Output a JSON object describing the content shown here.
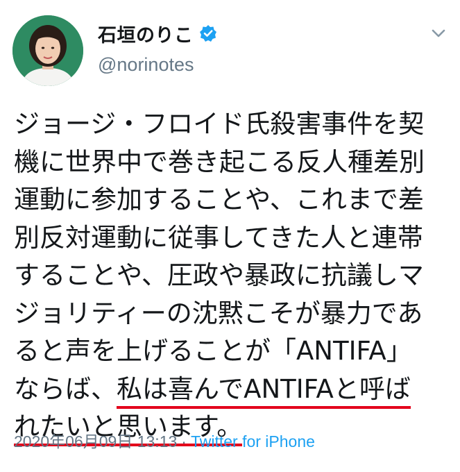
{
  "author": {
    "display_name": "石垣のりこ",
    "handle": "@norinotes",
    "verified": true
  },
  "tweet": {
    "lines": [
      "ジョージ・フロイド氏殺害事件を契",
      "機に世界中で巻き起こる反人種差別",
      "運動に参加することや、これまで差",
      "別反対運動に従事してきた人と連帯",
      "することや、圧政や暴政に抗議しマ",
      "ジョリティーの沈黙こそが暴力であ",
      "ると声を上げることが「ANTIFA」"
    ],
    "line8_plain": "ならば、",
    "line8_underlined": "私は喜んでANTIFAと呼ば",
    "line9_underlined": "れたいと思います。"
  },
  "meta": {
    "timestamp": "2020年06月09日 13:13",
    "separator": "·",
    "source": "Twitter for iPhone"
  },
  "colors": {
    "underline": "#e3001b",
    "verified_badge": "#1da1f2",
    "secondary_text": "#657786",
    "avatar_background": "#2e8b62"
  },
  "icons": {
    "verified": "verified-badge-icon",
    "menu": "chevron-down-icon"
  }
}
